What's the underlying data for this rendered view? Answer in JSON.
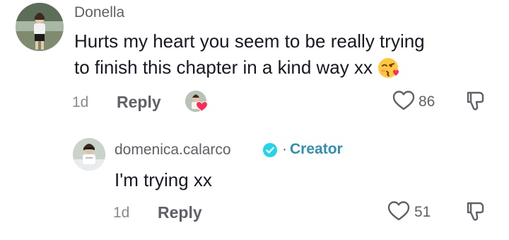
{
  "comment": {
    "author": "Donella",
    "text_lines": [
      "Hurts my heart you seem to be really trying",
      "to finish this chapter in a kind way xx"
    ],
    "emoji": "kissing-face-with-heart",
    "age": "1d",
    "reply_label": "Reply",
    "likes": "86",
    "creator_liked": true
  },
  "reply": {
    "author": "domenica.calarco",
    "verified": true,
    "separator": "·",
    "role_badge": "Creator",
    "text": "I'm trying xx",
    "age": "1d",
    "reply_label": "Reply",
    "likes": "51"
  },
  "colors": {
    "text_primary": "#161823",
    "text_secondary": "#5f6068",
    "text_muted": "#8a8b91",
    "creator": "#2f8fb5",
    "verified": "#20d5ec",
    "heart_red": "#fe2c55"
  }
}
